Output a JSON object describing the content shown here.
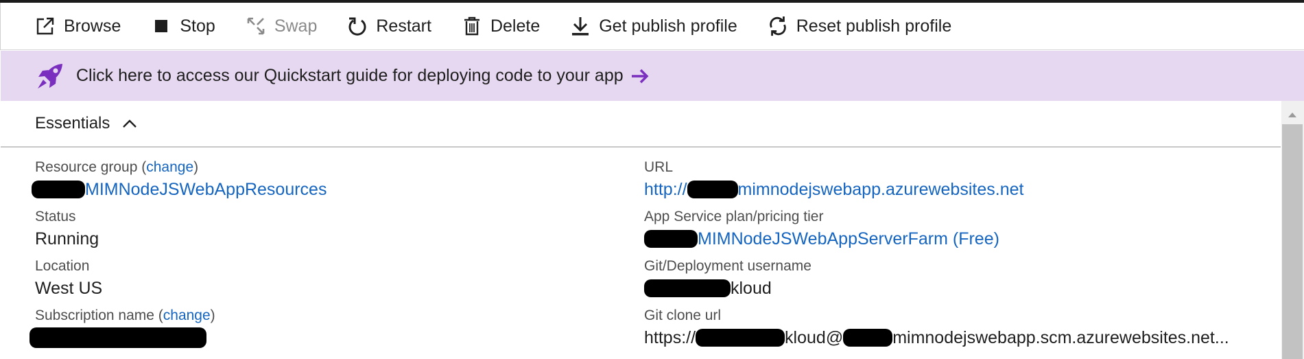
{
  "toolbar": {
    "browse": "Browse",
    "stop": "Stop",
    "swap": "Swap",
    "restart": "Restart",
    "delete": "Delete",
    "get_publish_profile": "Get publish profile",
    "reset_publish_profile": "Reset publish profile"
  },
  "banner": {
    "text": "Click here to access our Quickstart guide for deploying code to your app"
  },
  "essentials": {
    "title": "Essentials",
    "left": {
      "resource_group_label": "Resource group",
      "change_text": "change",
      "resource_group_value": "MIMNodeJSWebAppResources",
      "status_label": "Status",
      "status_value": "Running",
      "location_label": "Location",
      "location_value": "West US",
      "subscription_label": "Subscription name",
      "subscription_change": "change"
    },
    "right": {
      "url_label": "URL",
      "url_prefix": "http://",
      "url_value": "mimnodejswebapp.azurewebsites.net",
      "plan_label": "App Service plan/pricing tier",
      "plan_value": "MIMNodeJSWebAppServerFarm (Free)",
      "git_user_label": "Git/Deployment username",
      "git_user_value": "kloud",
      "git_clone_label": "Git clone url",
      "git_clone_prefix": "https://",
      "git_clone_mid": "kloud@",
      "git_clone_value": "mimnodejswebapp.scm.azurewebsites.net..."
    }
  },
  "colors": {
    "banner_bg": "#e7d8f1",
    "link": "#1565c0",
    "accent_purple": "#7b2fbf"
  }
}
